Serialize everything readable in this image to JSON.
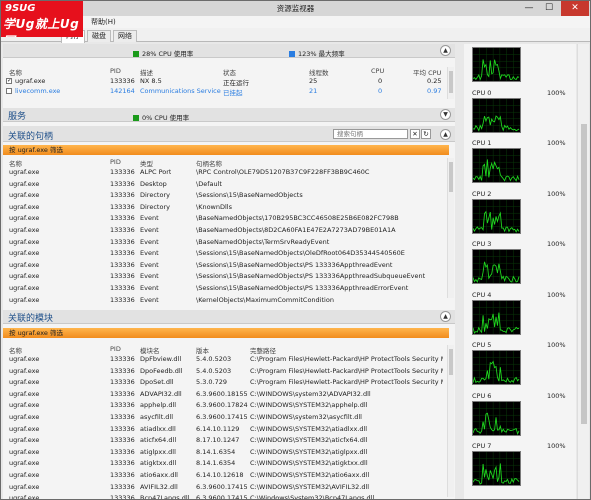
{
  "window": {
    "title": "资源监视器",
    "min": "—",
    "max": "☐",
    "close": "✕"
  },
  "logo": {
    "line1": "9SUG",
    "line2": "学Ug就上Ug网"
  },
  "menu": {
    "help": "帮助(H)"
  },
  "tabs": [
    {
      "label": "内存"
    },
    {
      "label": "磁盘"
    },
    {
      "label": "网络"
    }
  ],
  "cpu_section": {
    "cpu_usage": "28% CPU 使用率",
    "max_freq": "123% 最大频率",
    "columns": [
      "名称",
      "PID",
      "描述",
      "状态",
      "线程数",
      "CPU",
      "平均 CPU"
    ],
    "rows": [
      {
        "checked": true,
        "name": "ugraf.exe",
        "pid": "133336",
        "desc": "NX 8.5",
        "status": "正在运行",
        "threads": "25",
        "cpu": "0",
        "avg": "0.25",
        "blue": false
      },
      {
        "checked": false,
        "name": "livecomm.exe",
        "pid": "142164",
        "desc": "Communications Service",
        "status": "已挂起",
        "threads": "21",
        "cpu": "0",
        "avg": "0.97",
        "blue": true
      }
    ]
  },
  "services": {
    "title": "服务",
    "usage": "0% CPU 使用率"
  },
  "handles": {
    "title": "关联的句柄",
    "search_placeholder": "搜索句柄",
    "filter": "按 ugraf.exe 筛选",
    "columns": [
      "名称",
      "PID",
      "类型",
      "句柄名称"
    ],
    "rows": [
      [
        "ugraf.exe",
        "133336",
        "ALPC Port",
        "\\RPC Control\\OLE79D51207B37C9F228FF3BB9C460C"
      ],
      [
        "ugraf.exe",
        "133336",
        "Desktop",
        "\\Default"
      ],
      [
        "ugraf.exe",
        "133336",
        "Directory",
        "\\Sessions\\15\\BaseNamedObjects"
      ],
      [
        "ugraf.exe",
        "133336",
        "Directory",
        "\\KnownDlls"
      ],
      [
        "ugraf.exe",
        "133336",
        "Event",
        "\\BaseNamedObjects\\170B295BC3CC46508E25B6E082FC798B"
      ],
      [
        "ugraf.exe",
        "133336",
        "Event",
        "\\BaseNamedObjects\\8D2CA60FA1E47E2A7273AD79BE01A1A"
      ],
      [
        "ugraf.exe",
        "133336",
        "Event",
        "\\BaseNamedObjects\\TermSrvReadyEvent"
      ],
      [
        "ugraf.exe",
        "133336",
        "Event",
        "\\Sessions\\15\\BaseNamedObjects\\OleDfRoot064D35344540560E"
      ],
      [
        "ugraf.exe",
        "133336",
        "Event",
        "\\Sessions\\15\\BaseNamedObjects\\PS           133336AppthreadEvent"
      ],
      [
        "ugraf.exe",
        "133336",
        "Event",
        "\\Sessions\\15\\BaseNamedObjects\\PS           133336AppthreadSubqueueEvent"
      ],
      [
        "ugraf.exe",
        "133336",
        "Event",
        "\\Sessions\\15\\BaseNamedObjects\\PS           133336AppthreadErrorEvent"
      ],
      [
        "ugraf.exe",
        "133336",
        "Event",
        "\\KernelObjects\\MaximumCommitCondition"
      ]
    ]
  },
  "modules": {
    "title": "关联的模块",
    "filter": "按 ugraf.exe 筛选",
    "columns": [
      "名称",
      "PID",
      "模块名",
      "版本",
      "完整路径"
    ],
    "rows": [
      [
        "ugraf.exe",
        "133336",
        "DpFbview.dll",
        "5.4.0.5203",
        "C:\\Program Files\\Hewlett-Packard\\HP ProtectTools Security M..."
      ],
      [
        "ugraf.exe",
        "133336",
        "DpoFeedb.dll",
        "5.4.0.5203",
        "C:\\Program Files\\Hewlett-Packard\\HP ProtectTools Security M..."
      ],
      [
        "ugraf.exe",
        "133336",
        "DpoSet.dll",
        "5.3.0.729",
        "C:\\Program Files\\Hewlett-Packard\\HP ProtectTools Security M..."
      ],
      [
        "ugraf.exe",
        "133336",
        "ADVAPI32.dll",
        "6.3.9600.18155",
        "C:\\WINDOWS\\system32\\ADVAPI32.dll"
      ],
      [
        "ugraf.exe",
        "133336",
        "apphelp.dll",
        "6.3.9600.17824",
        "C:\\WINDOWS\\SYSTEM32\\apphelp.dll"
      ],
      [
        "ugraf.exe",
        "133336",
        "asycfilt.dll",
        "6.3.9600.17415",
        "C:\\WINDOWS\\system32\\asycfilt.dll"
      ],
      [
        "ugraf.exe",
        "133336",
        "atiadlxx.dll",
        "6.14.10.1129",
        "C:\\WINDOWS\\SYSTEM32\\atiadlxx.dll"
      ],
      [
        "ugraf.exe",
        "133336",
        "aticfx64.dll",
        "8.17.10.1247",
        "C:\\WINDOWS\\SYSTEM32\\aticfx64.dll"
      ],
      [
        "ugraf.exe",
        "133336",
        "atiglpxx.dll",
        "8.14.1.6354",
        "C:\\WINDOWS\\SYSTEM32\\atiglpxx.dll"
      ],
      [
        "ugraf.exe",
        "133336",
        "atigktxx.dll",
        "8.14.1.6354",
        "C:\\WINDOWS\\SYSTEM32\\atigktxx.dll"
      ],
      [
        "ugraf.exe",
        "133336",
        "atio6axx.dll",
        "6.14.10.12618",
        "C:\\WINDOWS\\SYSTEM32\\atio6axx.dll"
      ],
      [
        "ugraf.exe",
        "133336",
        "AVIFIL32.dll",
        "6.3.9600.17415",
        "C:\\WINDOWS\\SYSTEM32\\AVIFIL32.dll"
      ],
      [
        "ugraf.exe",
        "133336",
        "Bcp47Langs.dll",
        "6.3.9600.17415",
        "C:\\Windows\\System32\\Bcp47Langs.dll"
      ]
    ]
  },
  "cpu_cores": [
    {
      "label": "",
      "pct": "100%"
    },
    {
      "label": "CPU 0",
      "pct": "100%"
    },
    {
      "label": "CPU 1",
      "pct": "100%"
    },
    {
      "label": "CPU 2",
      "pct": "100%"
    },
    {
      "label": "CPU 3",
      "pct": "100%"
    },
    {
      "label": "CPU 4",
      "pct": "100%"
    },
    {
      "label": "CPU 5",
      "pct": "100%"
    },
    {
      "label": "CPU 6",
      "pct": "100%"
    },
    {
      "label": "CPU 7",
      "pct": "100%"
    }
  ],
  "colors": {
    "graph_line": "#1fd91f",
    "graph_bg": "#000000",
    "filter_orange": "#f6a030",
    "cpu_green": "#1a9a1a",
    "freq_blue": "#2a7de1",
    "link_blue": "#2a7de1"
  }
}
